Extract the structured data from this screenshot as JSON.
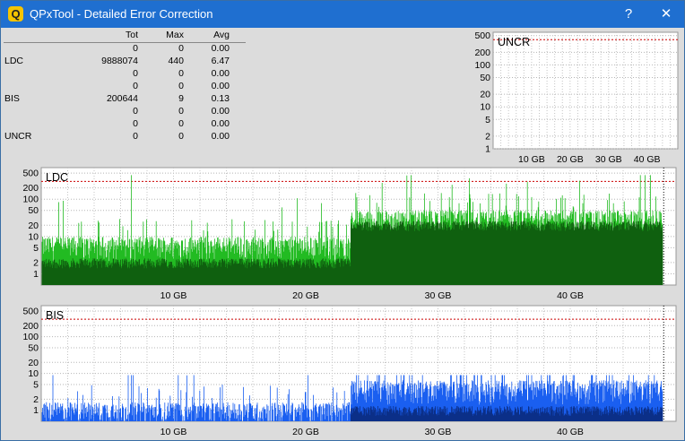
{
  "window": {
    "title": "QPxTool - Detailed Error Correction",
    "help_glyph": "?",
    "close_glyph": "✕",
    "icon_letter": "Q"
  },
  "stats": {
    "headers": [
      "Tot",
      "Max",
      "Avg"
    ],
    "rows": [
      {
        "label": "",
        "tot": "0",
        "max": "0",
        "avg": "0.00"
      },
      {
        "label": "LDC",
        "tot": "9888074",
        "max": "440",
        "avg": "6.47"
      },
      {
        "label": "",
        "tot": "0",
        "max": "0",
        "avg": "0.00"
      },
      {
        "label": "",
        "tot": "0",
        "max": "0",
        "avg": "0.00"
      },
      {
        "label": "BIS",
        "tot": "200644",
        "max": "9",
        "avg": "0.13"
      },
      {
        "label": "",
        "tot": "0",
        "max": "0",
        "avg": "0.00"
      },
      {
        "label": "",
        "tot": "0",
        "max": "0",
        "avg": "0.00"
      },
      {
        "label": "UNCR",
        "tot": "0",
        "max": "0",
        "avg": "0.00"
      }
    ]
  },
  "colors": {
    "ldc": "#22bb22",
    "ldc_dark": "#0f600f",
    "bis": "#1a5ff0",
    "bis_dark": "#0b2f88",
    "limit": "#cc0000"
  },
  "chart_data": [
    {
      "type": "area",
      "title": "UNCR",
      "xlabel": "",
      "ylabel": "",
      "yscale": "log",
      "ylim": [
        1,
        600
      ],
      "xlim": [
        0,
        48
      ],
      "yticks": [
        1,
        2,
        5,
        10,
        20,
        50,
        100,
        200,
        500
      ],
      "xticks": [
        10,
        20,
        30,
        40
      ],
      "xtick_labels": [
        "10 GB",
        "20 GB",
        "30 GB",
        "40 GB"
      ],
      "limit_line": 400,
      "series": [
        {
          "values": []
        }
      ]
    },
    {
      "type": "area",
      "title": "LDC",
      "xlabel": "",
      "ylabel": "",
      "yscale": "log",
      "ylim": [
        0.5,
        700
      ],
      "xlim": [
        0,
        48
      ],
      "yticks": [
        1,
        2,
        5,
        10,
        20,
        50,
        100,
        200,
        500
      ],
      "xticks": [
        10,
        20,
        30,
        40
      ],
      "xtick_labels": [
        "10 GB",
        "20 GB",
        "30 GB",
        "40 GB"
      ],
      "limit_line": 300,
      "series": [
        {
          "x_end": 47.0,
          "peak": 440,
          "segments": [
            {
              "x0": 0,
              "x1": 23.4,
              "typical": 6,
              "dark_level": 2
            },
            {
              "x0": 23.4,
              "x1": 47.0,
              "typical": 30,
              "dark_level": 20
            }
          ]
        }
      ]
    },
    {
      "type": "area",
      "title": "BIS",
      "xlabel": "",
      "ylabel": "",
      "yscale": "log",
      "ylim": [
        0.5,
        700
      ],
      "xlim": [
        0,
        48
      ],
      "yticks": [
        1,
        2,
        5,
        10,
        20,
        50,
        100,
        200,
        500
      ],
      "xticks": [
        10,
        20,
        30,
        40
      ],
      "xtick_labels": [
        "10 GB",
        "20 GB",
        "30 GB",
        "40 GB"
      ],
      "limit_line": 300,
      "series": [
        {
          "x_end": 47.0,
          "peak": 9,
          "segments": [
            {
              "x0": 0,
              "x1": 23.4,
              "typical": 1,
              "dark_level": 0
            },
            {
              "x0": 23.4,
              "x1": 47.0,
              "typical": 4,
              "dark_level": 1
            }
          ]
        }
      ]
    }
  ]
}
